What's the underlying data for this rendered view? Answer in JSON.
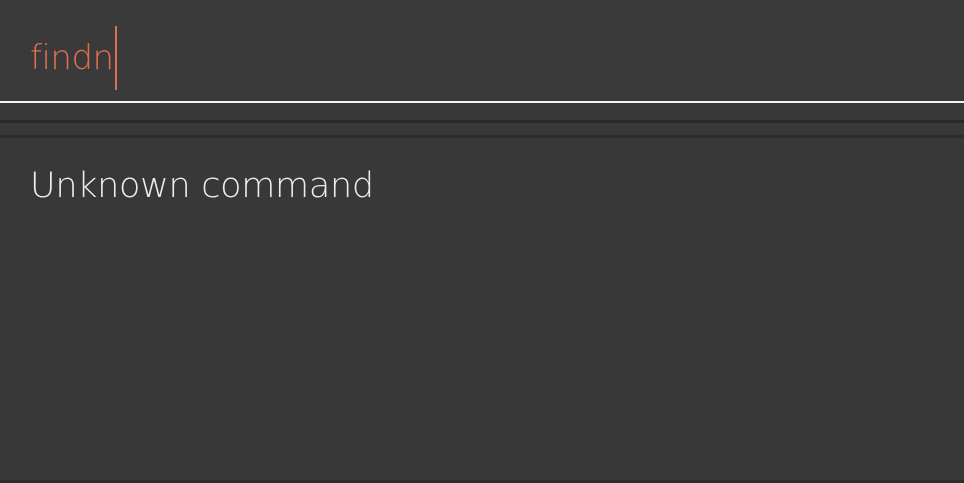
{
  "command_box": {
    "value": "findn"
  },
  "result_display": {
    "message": "Unknown command"
  },
  "colors": {
    "background": "#383838",
    "input_text": "#e0704f",
    "result_text": "#ececec",
    "underline": "#f2f2f2"
  }
}
